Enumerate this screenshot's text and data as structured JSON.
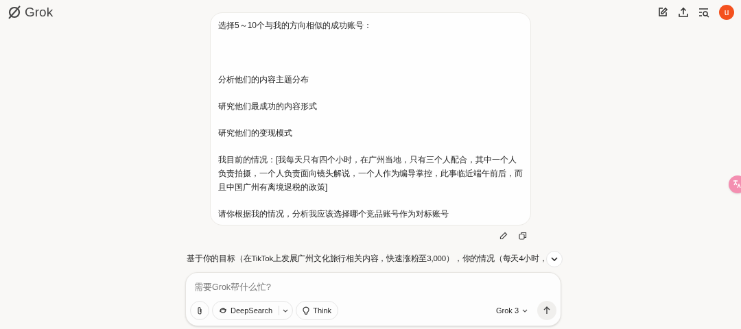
{
  "header": {
    "logo": "Grok",
    "avatar": "u"
  },
  "user_message": {
    "paragraphs": [
      "选择5～10个与我的方向相似的成功账号：",
      "分析他们的内容主题分布",
      "研究他们最成功的内容形式",
      "研究他们的变现模式",
      "我目前的情况：[我每天只有四个小时，在广州当地，只有三个人配合，其中一个人负责拍摄，一个人负责面向镜头解说，一个人作为编导掌控，此事临近端午前后，而且中国广州有离境退税的政策]",
      "请你根据我的情况，分析我应该选择哪个竞品账号作为对标账号"
    ]
  },
  "response": {
    "text": "基于你的目标（在TikTok上发展广州文化旅行相关内容，快速涨粉至3,000），你的情况（每天4小时，"
  },
  "composer": {
    "placeholder": "需要Grok帮什么忙?",
    "deepsearch": "DeepSearch",
    "think": "Think",
    "model": "Grok 3"
  }
}
